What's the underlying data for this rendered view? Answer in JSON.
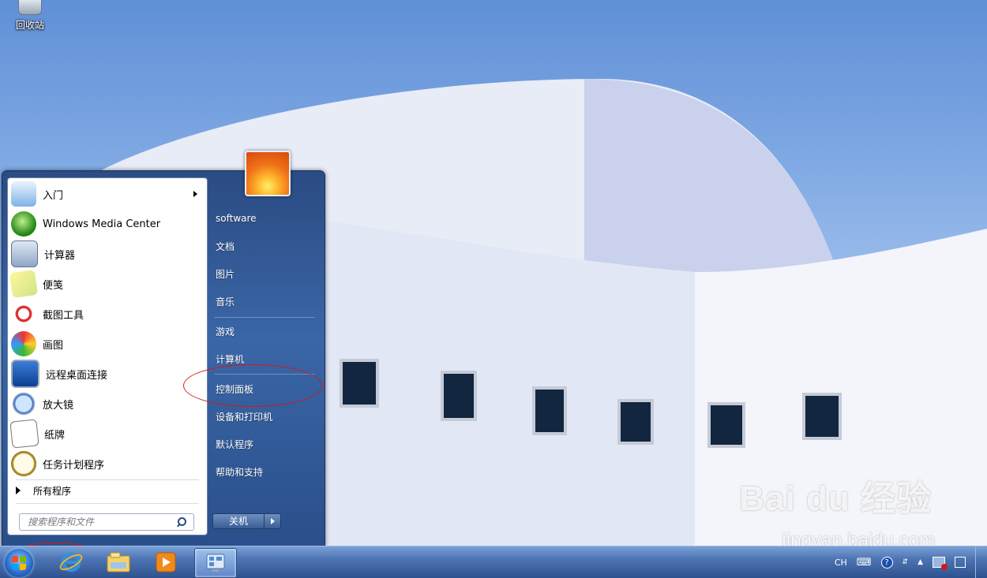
{
  "desktop": {
    "recycle_bin_label": "回收站",
    "watermark_main": "Bai du 经验",
    "watermark_sub": "jingyan.baidu.com"
  },
  "start_menu": {
    "programs": [
      {
        "label": "入门",
        "icon": "getting-started-icon",
        "has_submenu": true
      },
      {
        "label": "Windows Media Center",
        "icon": "media-center-icon",
        "has_submenu": false
      },
      {
        "label": "计算器",
        "icon": "calculator-icon",
        "has_submenu": false
      },
      {
        "label": "便笺",
        "icon": "sticky-notes-icon",
        "has_submenu": false
      },
      {
        "label": "截图工具",
        "icon": "snipping-tool-icon",
        "has_submenu": false
      },
      {
        "label": "画图",
        "icon": "paint-icon",
        "has_submenu": false
      },
      {
        "label": "远程桌面连接",
        "icon": "remote-desktop-icon",
        "has_submenu": false
      },
      {
        "label": "放大镜",
        "icon": "magnifier-icon",
        "has_submenu": false
      },
      {
        "label": "纸牌",
        "icon": "solitaire-icon",
        "has_submenu": false
      },
      {
        "label": "任务计划程序",
        "icon": "task-scheduler-icon",
        "has_submenu": false
      }
    ],
    "all_programs": "所有程序",
    "search_placeholder": "搜索程序和文件",
    "right_items": [
      {
        "label": "software"
      },
      {
        "label": "文档"
      },
      {
        "label": "图片"
      },
      {
        "label": "音乐"
      },
      {
        "label": "游戏"
      },
      {
        "label": "计算机"
      },
      {
        "label": "控制面板"
      },
      {
        "label": "设备和打印机"
      },
      {
        "label": "默认程序"
      },
      {
        "label": "帮助和支持"
      }
    ],
    "shutdown_label": "关机"
  },
  "taskbar": {
    "pinned": [
      {
        "icon": "internet-explorer-icon"
      },
      {
        "icon": "file-explorer-icon"
      },
      {
        "icon": "media-player-icon"
      },
      {
        "icon": "control-panel-icon"
      }
    ],
    "tray": {
      "language": "CH"
    }
  },
  "colors": {
    "annotation": "#d21a1a",
    "menu_right_pane": "#3a66a7",
    "taskbar": "#4d74b3"
  }
}
